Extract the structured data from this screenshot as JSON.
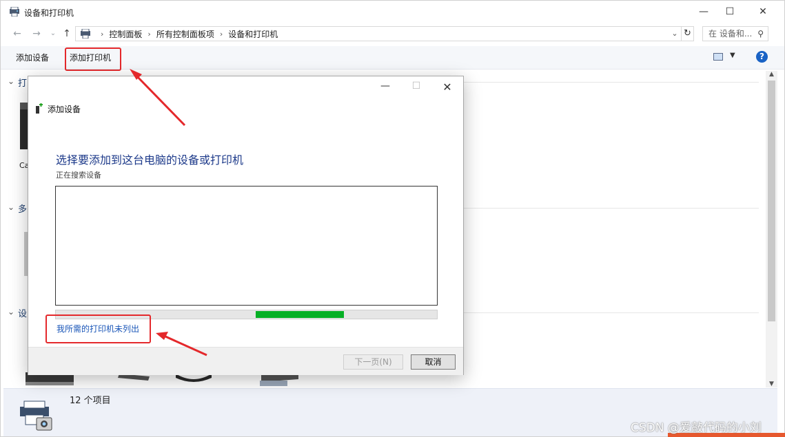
{
  "window": {
    "title": "设备和打印机",
    "controls": {
      "minimize": "—",
      "maximize": "☐",
      "close": "✕"
    }
  },
  "address": {
    "crumbs": [
      "控制面板",
      "所有控制面板项",
      "设备和打印机"
    ],
    "search_placeholder": "在 设备和...",
    "back": "←",
    "forward": "→",
    "recent": "⌄",
    "up": "↑",
    "dropdown": "⌄",
    "refresh": "↻"
  },
  "toolbar": {
    "add_device": "添加设备",
    "add_printer": "添加打印机",
    "help": "?"
  },
  "sections": [
    {
      "label": "打",
      "chevron": "⌄"
    },
    {
      "label": "多",
      "chevron": "⌄"
    },
    {
      "label": "设",
      "chevron": "⌄"
    }
  ],
  "background_text": {
    "device_label_partial": "Ca"
  },
  "status": {
    "item_count": "12 个项目"
  },
  "dialog": {
    "title": "添加设备",
    "heading": "选择要添加到这台电脑的设备或打印机",
    "subtext": "正在搜索设备",
    "progress_fraction": {
      "start": 0.525,
      "end": 0.755
    },
    "link": "我所需的打印机未列出",
    "next_button": "下一页(N)",
    "cancel_button": "取消",
    "controls": {
      "minimize": "—",
      "maximize": "☐",
      "close": "✕"
    }
  },
  "watermark": "CSDN @爱敲代码的小刘",
  "colors": {
    "accent_red": "#e4282b",
    "progress_green": "#06b025",
    "link_blue": "#1a56b8",
    "heading_blue": "#1d3a8a"
  }
}
